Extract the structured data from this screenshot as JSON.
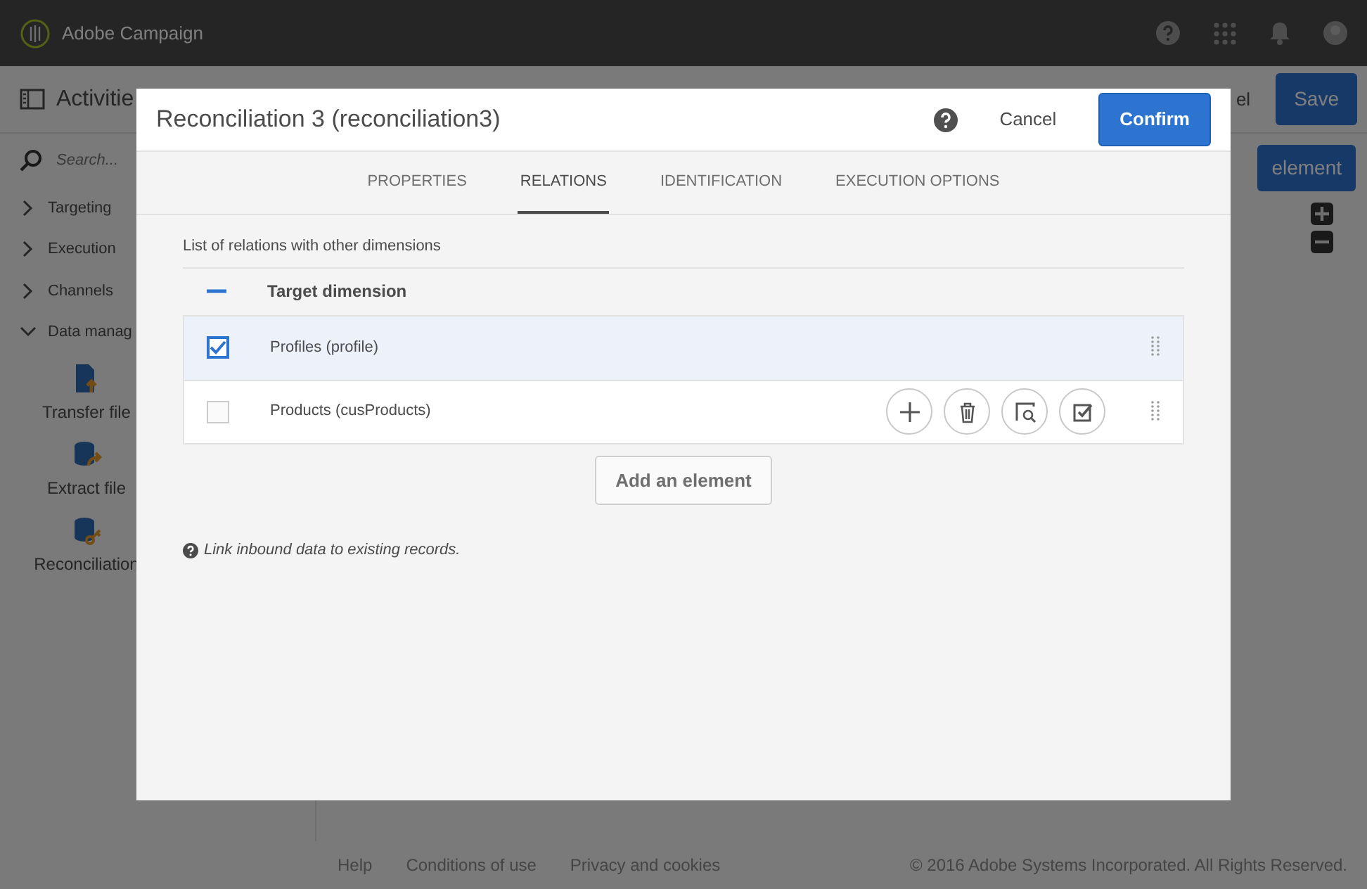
{
  "app": {
    "title": "Adobe Campaign"
  },
  "toolbar": {
    "title": "Activitie",
    "cancel_button": "el",
    "save_button": "Save",
    "add_button": "element"
  },
  "sidebar": {
    "search": {
      "placeholder": "Search..."
    },
    "groups": [
      {
        "label": "Targeting",
        "expanded": false
      },
      {
        "label": "Execution",
        "expanded": false
      },
      {
        "label": "Channels",
        "expanded": false
      },
      {
        "label": "Data manag",
        "expanded": true,
        "items": [
          {
            "label": "Transfer file",
            "kind": "transfer"
          },
          {
            "label": "Extract file",
            "kind": "extract"
          },
          {
            "label": "Reconciliation",
            "kind": "reconciliation"
          }
        ]
      }
    ]
  },
  "footer": {
    "links": [
      "Help",
      "Conditions of use",
      "Privacy and cookies"
    ],
    "copyright": "© 2016 Adobe Systems Incorporated. All Rights Reserved."
  },
  "dialog": {
    "title": "Reconciliation 3 (reconciliation3)",
    "cancel_button": "Cancel",
    "confirm_button": "Confirm",
    "tabs": [
      {
        "label": "PROPERTIES",
        "selected": false
      },
      {
        "label": "RELATIONS",
        "selected": true
      },
      {
        "label": "IDENTIFICATION",
        "selected": false
      },
      {
        "label": "EXECUTION OPTIONS",
        "selected": false
      }
    ],
    "section_title": "List of relations with other dimensions",
    "table": {
      "header": "Target dimension",
      "partially_selected": true,
      "rows": [
        {
          "label": "Profiles (profile)",
          "checked": true,
          "selected": true,
          "show_actions": false
        },
        {
          "label": "Products (cusProducts)",
          "checked": false,
          "selected": false,
          "show_actions": true
        }
      ]
    },
    "add_button": "Add an element",
    "note": "Link inbound data to existing records."
  }
}
